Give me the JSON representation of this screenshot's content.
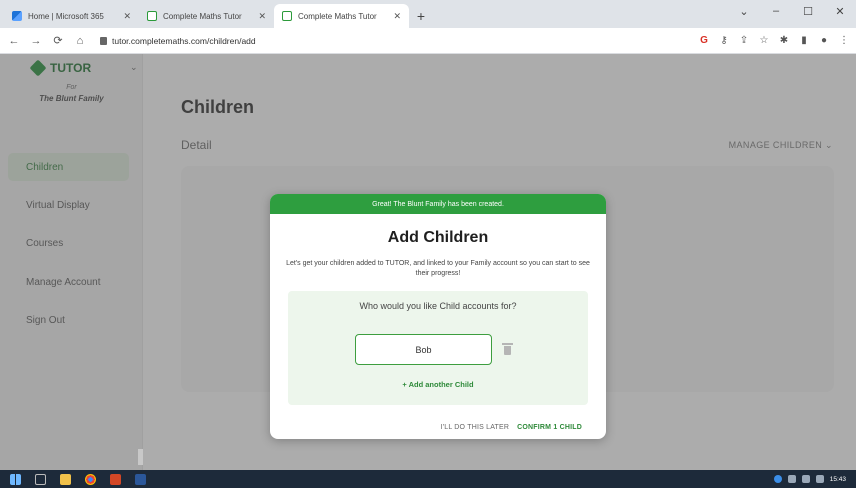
{
  "browser": {
    "tabs": [
      {
        "title": "Home | Microsoft 365",
        "favicon": "microsoft-365-icon",
        "active": false
      },
      {
        "title": "Complete Maths Tutor",
        "favicon": "complete-maths-icon",
        "active": false
      },
      {
        "title": "Complete Maths Tutor",
        "favicon": "complete-maths-icon",
        "active": true
      }
    ],
    "new_tab": "+",
    "url": "tutor.completemaths.com/children/add"
  },
  "sidebar": {
    "logo": "TUTOR",
    "for_label": "For",
    "family_name": "The Blunt Family",
    "items": [
      {
        "label": "Children",
        "active": true
      },
      {
        "label": "Virtual Display",
        "active": false
      },
      {
        "label": "Courses",
        "active": false
      },
      {
        "label": "Manage Account",
        "active": false
      },
      {
        "label": "Sign Out",
        "active": false
      }
    ]
  },
  "main": {
    "title": "Children",
    "detail_label": "Detail",
    "manage_children": "MANAGE CHILDREN"
  },
  "modal": {
    "banner": "Great! The Blunt Family has been created.",
    "title": "Add Children",
    "description": "Let's get your children added to TUTOR, and linked to your Family account so you can start to see their progress!",
    "question": "Who would you like Child accounts for?",
    "child_name_value": "Bob",
    "add_another_label": "+ Add another Child",
    "later_button": "I'LL DO THIS LATER",
    "confirm_button": "CONFIRM 1 CHILD"
  },
  "taskbar": {
    "time": "15:43"
  },
  "colors": {
    "brand_green": "#2e9e3f",
    "active_menu_bg": "#d9e6d6",
    "panel_bg": "#edf6ec"
  }
}
